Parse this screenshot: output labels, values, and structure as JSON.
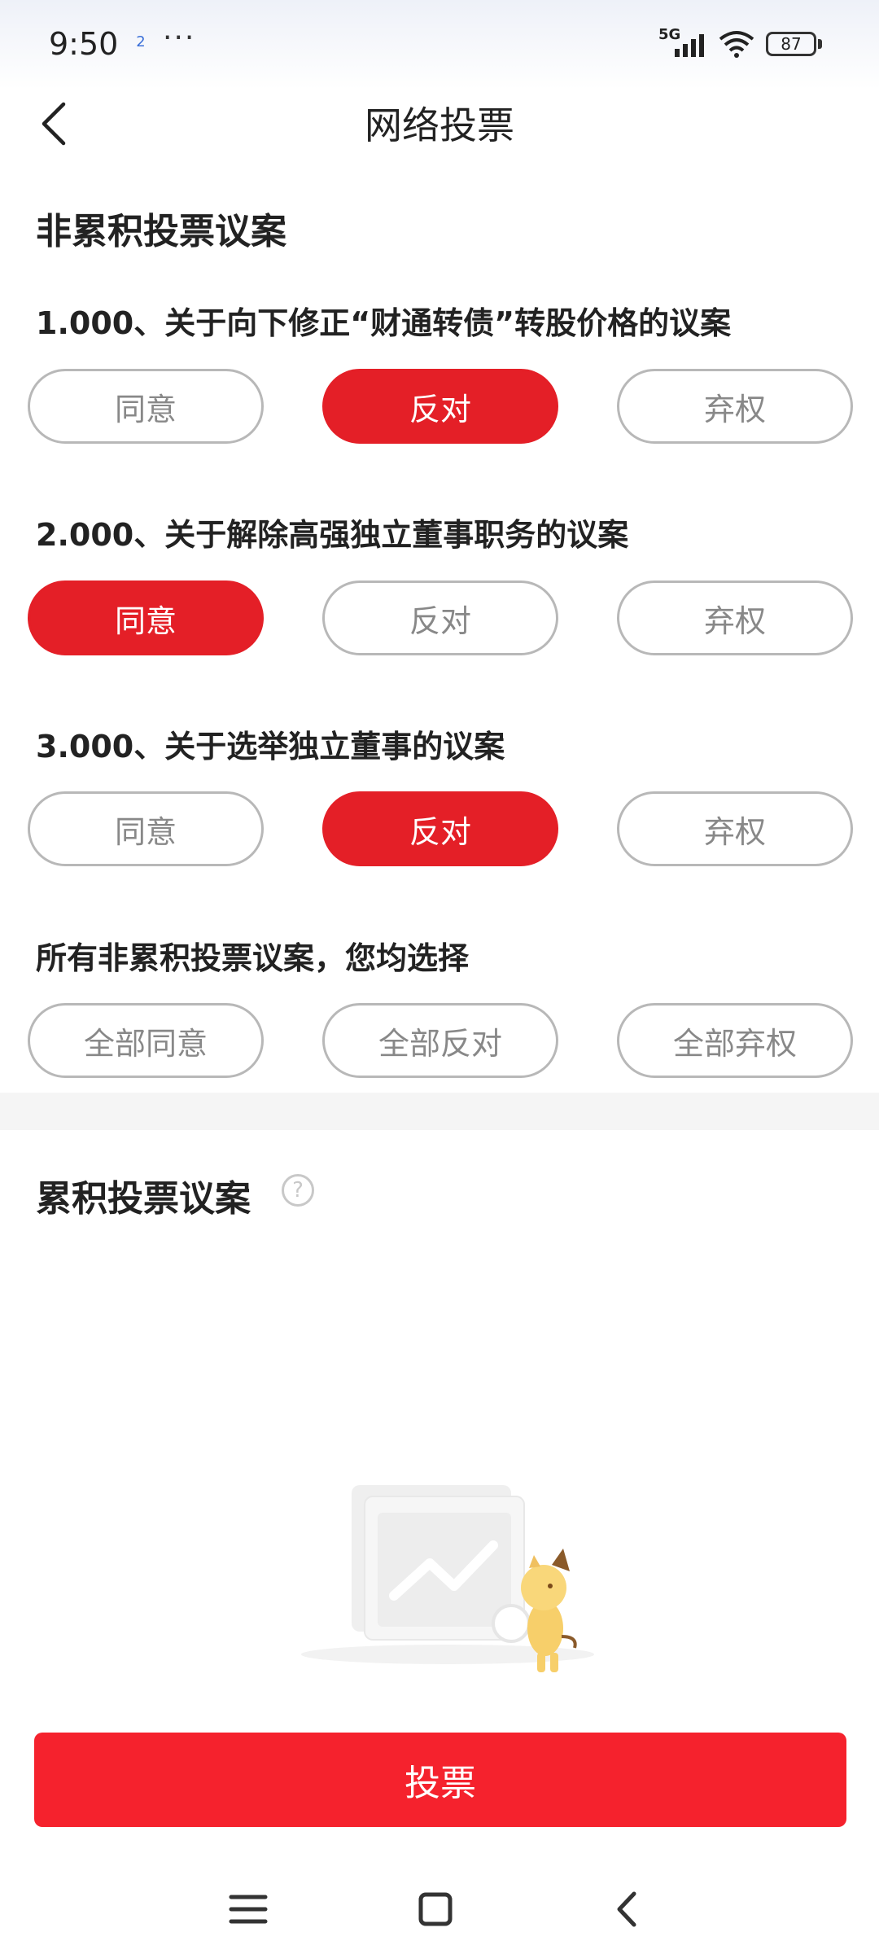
{
  "status": {
    "time": "9:50",
    "notification_badge": "2",
    "dots": "···",
    "network": "5G",
    "battery": "87"
  },
  "header": {
    "title": "网络投票"
  },
  "non_cumulative": {
    "section_title": "非累积投票议案",
    "motions": [
      {
        "title": "1.000、关于向下修正“财通转债”转股价格的议案",
        "options": [
          "同意",
          "反对",
          "弃权"
        ],
        "selected": "反对"
      },
      {
        "title": "2.000、关于解除高强独立董事职务的议案",
        "options": [
          "同意",
          "反对",
          "弃权"
        ],
        "selected": "同意"
      },
      {
        "title": "3.000、关于选举独立董事的议案",
        "options": [
          "同意",
          "反对",
          "弃权"
        ],
        "selected": "反对"
      }
    ],
    "bulk_title": "所有非累积投票议案，您均选择",
    "bulk_options": [
      "全部同意",
      "全部反对",
      "全部弃权"
    ]
  },
  "cumulative": {
    "section_title": "累积投票议案",
    "help_icon": "question-circle-icon"
  },
  "vote_button": "投票",
  "colors": {
    "accent": "#e41f27",
    "vote_button": "#f5222d"
  }
}
